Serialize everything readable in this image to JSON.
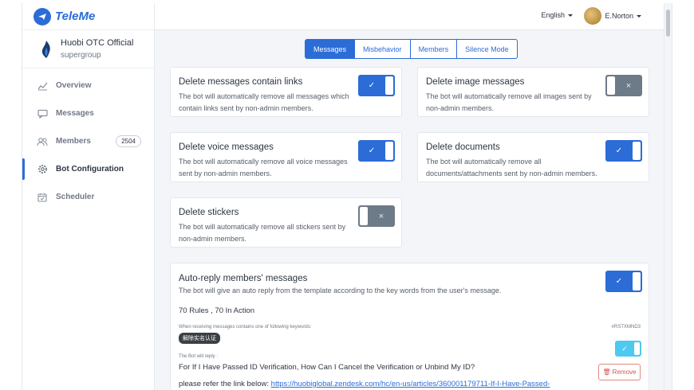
{
  "app": {
    "name": "TeleMe"
  },
  "group": {
    "title": "Huobi OTC Official",
    "subtitle": "supergroup"
  },
  "sidebar": {
    "items": [
      {
        "label": "Overview",
        "icon": "chart-icon"
      },
      {
        "label": "Messages",
        "icon": "chat-icon"
      },
      {
        "label": "Members",
        "icon": "users-icon",
        "badge": "2504"
      },
      {
        "label": "Bot Configuration",
        "icon": "gear-icon",
        "active": true
      },
      {
        "label": "Scheduler",
        "icon": "calendar-icon"
      }
    ]
  },
  "topbar": {
    "language": "English",
    "username": "E.Norton"
  },
  "tabs": [
    {
      "label": "Messages",
      "active": true
    },
    {
      "label": "Misbehavior"
    },
    {
      "label": "Members"
    },
    {
      "label": "Silence Mode"
    }
  ],
  "cards": [
    {
      "title": "Delete messages contain links",
      "desc": "The bot will automatically remove all messages which contain links sent by non-admin members.",
      "enabled": true
    },
    {
      "title": "Delete image messages",
      "desc": "The bot will automatically remove all images sent by non-admin members.",
      "enabled": false
    },
    {
      "title": "Delete voice messages",
      "desc": "The bot will automatically remove all voice messages sent by non-admin members.",
      "enabled": true
    },
    {
      "title": "Delete documents",
      "desc": "The bot will automatically remove all documents/attachments sent by non-admin members.",
      "enabled": true
    },
    {
      "title": "Delete stickers",
      "desc": "The bot will automatically remove all stickers sent by non-admin members.",
      "enabled": false
    }
  ],
  "auto_reply": {
    "title": "Auto-reply members' messages",
    "desc": "The bot will give an auto reply from the template according to the key words from the user's message.",
    "count": "70 Rules , 70 In Action",
    "enabled": true,
    "rule": {
      "keywords_label": "When receiving messages contains one of following keywords:",
      "code": "#RSTXMND3",
      "keyword": "解除实名认证",
      "reply_label": "The Bot will reply :",
      "reply_question": "For If I Have Passed ID Verification, How Can I Cancel the Verification or Unbind My ID?",
      "reply_link_prefix": "please refer the link below: ",
      "reply_link": "https://huobiglobal.zendesk.com/hc/en-us/articles/360001179711-If-I-Have-Passed-",
      "remove_label": "Remove",
      "enabled": true
    }
  },
  "colors": {
    "accent": "#2b6cd6",
    "off": "#6d7a88",
    "light_toggle": "#4ec9ef",
    "danger": "#d9534f"
  }
}
